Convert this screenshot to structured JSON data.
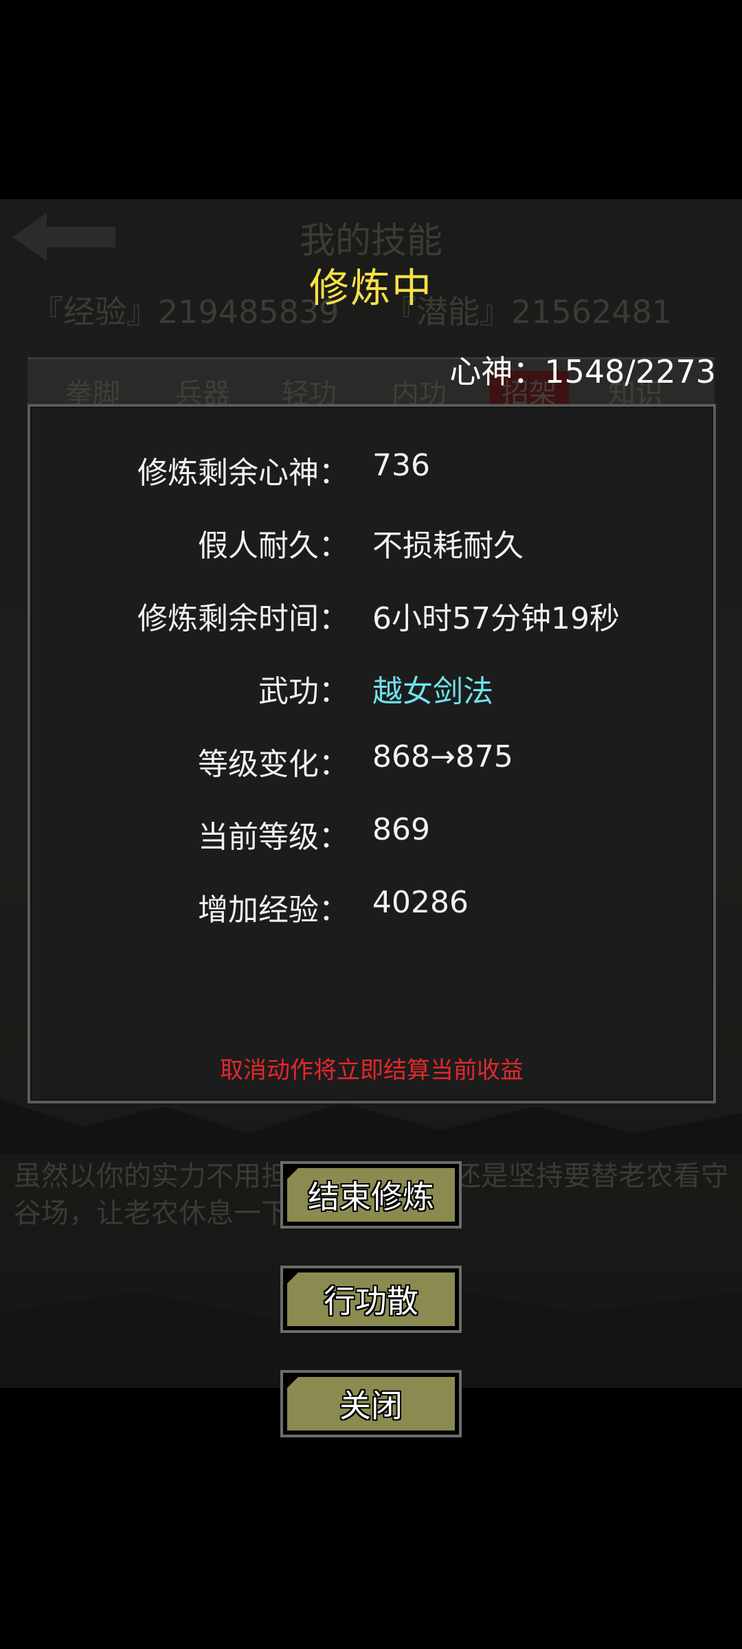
{
  "background": {
    "title": "我的技能",
    "exp_text": "『经验』219485839",
    "potential_text": "『潜能』21562481",
    "tabs": [
      "拳脚",
      "兵器",
      "轻功",
      "内功",
      "招架",
      "知识"
    ],
    "story_text": "虽然以你的实力不用担心这些，但你还是坚持要替老农看守谷场，让老农休息一下。"
  },
  "dialog": {
    "title": "修炼中",
    "mind": "心神：1548/2273",
    "rows": [
      {
        "label": "修炼剩余心神：",
        "value": "736"
      },
      {
        "label": "假人耐久：",
        "value": "不损耗耐久"
      },
      {
        "label": "修炼剩余时间：",
        "value": "6小时57分钟19秒"
      },
      {
        "label": "武功：",
        "value": "越女剑法"
      },
      {
        "label": "等级变化：",
        "value": "868→875"
      },
      {
        "label": "当前等级：",
        "value": "869"
      },
      {
        "label": "增加经验：",
        "value": "40286"
      }
    ],
    "warning": "取消动作将立即结算当前收益"
  },
  "buttons": {
    "end_training": "结束修炼",
    "xinggongsan": "行功散",
    "close": "关闭"
  },
  "colors": {
    "title": "#f7e04a",
    "skill": "#6fe2ea",
    "warning": "#e3282b",
    "button_face": "#8b8a50"
  }
}
